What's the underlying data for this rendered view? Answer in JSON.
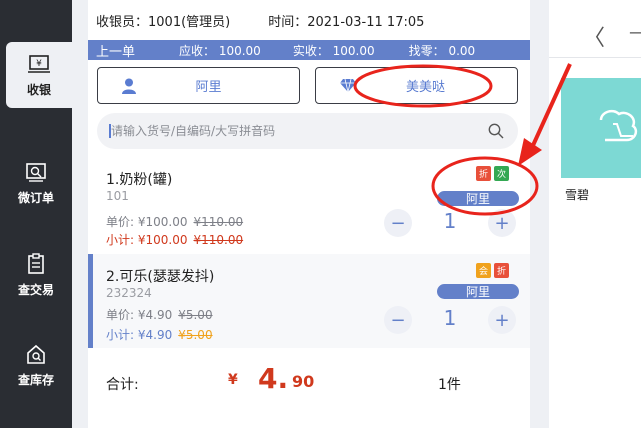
{
  "sidebar": {
    "items": [
      {
        "label": "收银",
        "icon": "cash-register-icon"
      },
      {
        "label": "微订单",
        "icon": "micro-order-icon"
      },
      {
        "label": "查交易",
        "icon": "transaction-icon"
      },
      {
        "label": "查库存",
        "icon": "inventory-icon"
      }
    ]
  },
  "header": {
    "cashier": "收银员：1001(管理员)",
    "time": "时间：2021-03-11 17:05"
  },
  "bar": {
    "prev": "上一单",
    "due": "应收： 100.00",
    "paid": "实收： 100.00",
    "change": "找零： 0.00"
  },
  "buttons": {
    "member": "阿里",
    "vip": "美美哒"
  },
  "search": {
    "placeholder": "请输入货号/自编码/大写拼音码"
  },
  "cart": [
    {
      "name": "1.奶粉(罐)",
      "code": "101",
      "unit_label": "单价: ¥100.00",
      "unit_orig": "¥110.00",
      "sub_label": "小计: ¥100.00",
      "sub_orig": "¥110.00",
      "tags": [
        {
          "text": "折",
          "color": "#e8503a"
        },
        {
          "text": "次",
          "color": "#34a853"
        }
      ],
      "member_tag": "阿里",
      "qty": "1"
    },
    {
      "name": "2.可乐(瑟瑟发抖)",
      "code": "232324",
      "unit_label": "单价: ¥4.90",
      "unit_orig": "¥5.00",
      "sub_label": "小计: ¥4.90",
      "sub_orig": "¥5.00",
      "tags": [
        {
          "text": "会",
          "color": "#f0a21d"
        },
        {
          "text": "折",
          "color": "#e8503a"
        }
      ],
      "member_tag": "阿里",
      "qty": "1"
    }
  ],
  "total": {
    "label": "合计:",
    "currency": "¥",
    "integer": "4.",
    "decimal": "90",
    "count": "1件"
  },
  "right": {
    "back": "〈",
    "product_name": "雪碧"
  },
  "colors": {
    "accent": "#6380c9",
    "sidebar": "#2a2d33",
    "price_red": "#d0391d",
    "annotation": "#e8241c"
  }
}
